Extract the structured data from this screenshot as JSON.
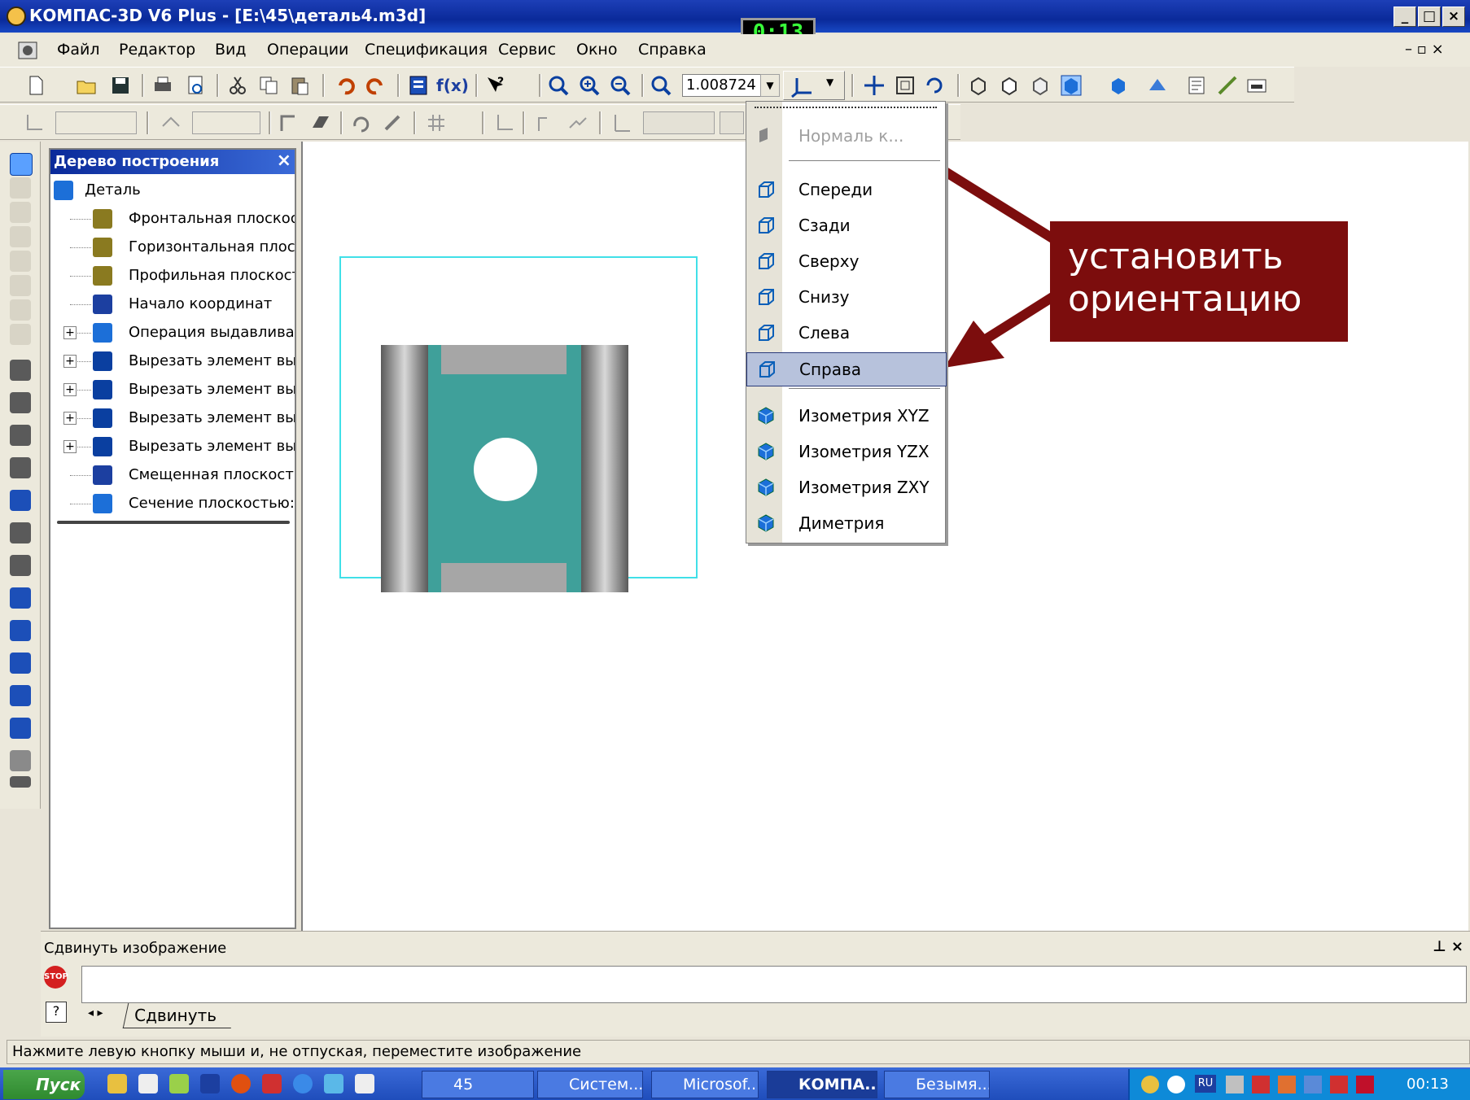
{
  "window": {
    "title": "КОМПАС-3D V6 Plus - [E:\\45\\деталь4.m3d]",
    "controls": [
      "_",
      "□",
      "×"
    ],
    "mdi_controls": "–  ▫  ×"
  },
  "timer": "0:13",
  "menu": [
    {
      "label": "Файл"
    },
    {
      "label": "Редактор"
    },
    {
      "label": "Вид"
    },
    {
      "label": "Операции"
    },
    {
      "label": "Спецификация"
    },
    {
      "label": "Сервис"
    },
    {
      "label": "Окно"
    },
    {
      "label": "Справка"
    }
  ],
  "toolbar": {
    "zoom_value": "1.008724",
    "function_label": "f(x)"
  },
  "tree": {
    "title": "Дерево построения",
    "items": [
      {
        "label": "Деталь",
        "icon": "part-icon",
        "expandable": false
      },
      {
        "label": "Фронтальная плоскост",
        "icon": "plane-icon",
        "expandable": false
      },
      {
        "label": "Горизонтальная плоск",
        "icon": "plane-icon",
        "expandable": false
      },
      {
        "label": "Профильная плоскости",
        "icon": "plane-icon",
        "expandable": false
      },
      {
        "label": "Начало координат",
        "icon": "origin-icon",
        "expandable": false
      },
      {
        "label": "Операция выдавливан",
        "icon": "extrude-icon",
        "expandable": true
      },
      {
        "label": "Вырезать элемент вы",
        "icon": "cut-icon",
        "expandable": true
      },
      {
        "label": "Вырезать элемент вы",
        "icon": "cut-icon",
        "expandable": true
      },
      {
        "label": "Вырезать элемент вы",
        "icon": "cut-icon",
        "expandable": true
      },
      {
        "label": "Вырезать элемент вы",
        "icon": "cut-icon",
        "expandable": true
      },
      {
        "label": "Смещенная плоскость",
        "icon": "offset-plane-icon",
        "expandable": false
      },
      {
        "label": "Сечение плоскостью:",
        "icon": "section-icon",
        "expandable": false
      }
    ]
  },
  "orientation_menu": {
    "header": "Нормаль к...",
    "items": [
      {
        "label": "Спереди",
        "icon": "view-front-icon"
      },
      {
        "label": "Сзади",
        "icon": "view-back-icon"
      },
      {
        "label": "Сверху",
        "icon": "view-top-icon"
      },
      {
        "label": "Снизу",
        "icon": "view-bottom-icon"
      },
      {
        "label": "Слева",
        "icon": "view-left-icon"
      },
      {
        "label": "Справа",
        "icon": "view-right-icon",
        "selected": true
      }
    ],
    "iso_items": [
      {
        "label": "Изометрия XYZ",
        "icon": "iso-xyz-icon"
      },
      {
        "label": "Изометрия YZX",
        "icon": "iso-yzx-icon"
      },
      {
        "label": "Изометрия ZXY",
        "icon": "iso-zxy-icon"
      },
      {
        "label": "Диметрия",
        "icon": "dimetric-icon"
      }
    ]
  },
  "callout": {
    "line1": "установить",
    "line2": "ориентацию"
  },
  "command_panel": {
    "title": "Сдвинуть изображение",
    "tab": "Сдвинуть",
    "pin": "⊥ ×"
  },
  "status_bar": "Нажмите левую кнопку мыши и, не отпуская, переместите изображение",
  "taskbar": {
    "start": "Пуск",
    "items": [
      {
        "label": "45"
      },
      {
        "label": "Систем..."
      },
      {
        "label": "Microsof..."
      },
      {
        "label": "КОМПА...",
        "active": true
      },
      {
        "label": "Безымя..."
      }
    ],
    "clock": "00:13",
    "lang": "RU"
  },
  "colors": {
    "title_bar": "#0a2a9a",
    "callout_bg": "#7c0d0d",
    "arrow": "#7c0d0d",
    "model_teal": "#3fa09a",
    "selection": "#b7c2dc"
  }
}
